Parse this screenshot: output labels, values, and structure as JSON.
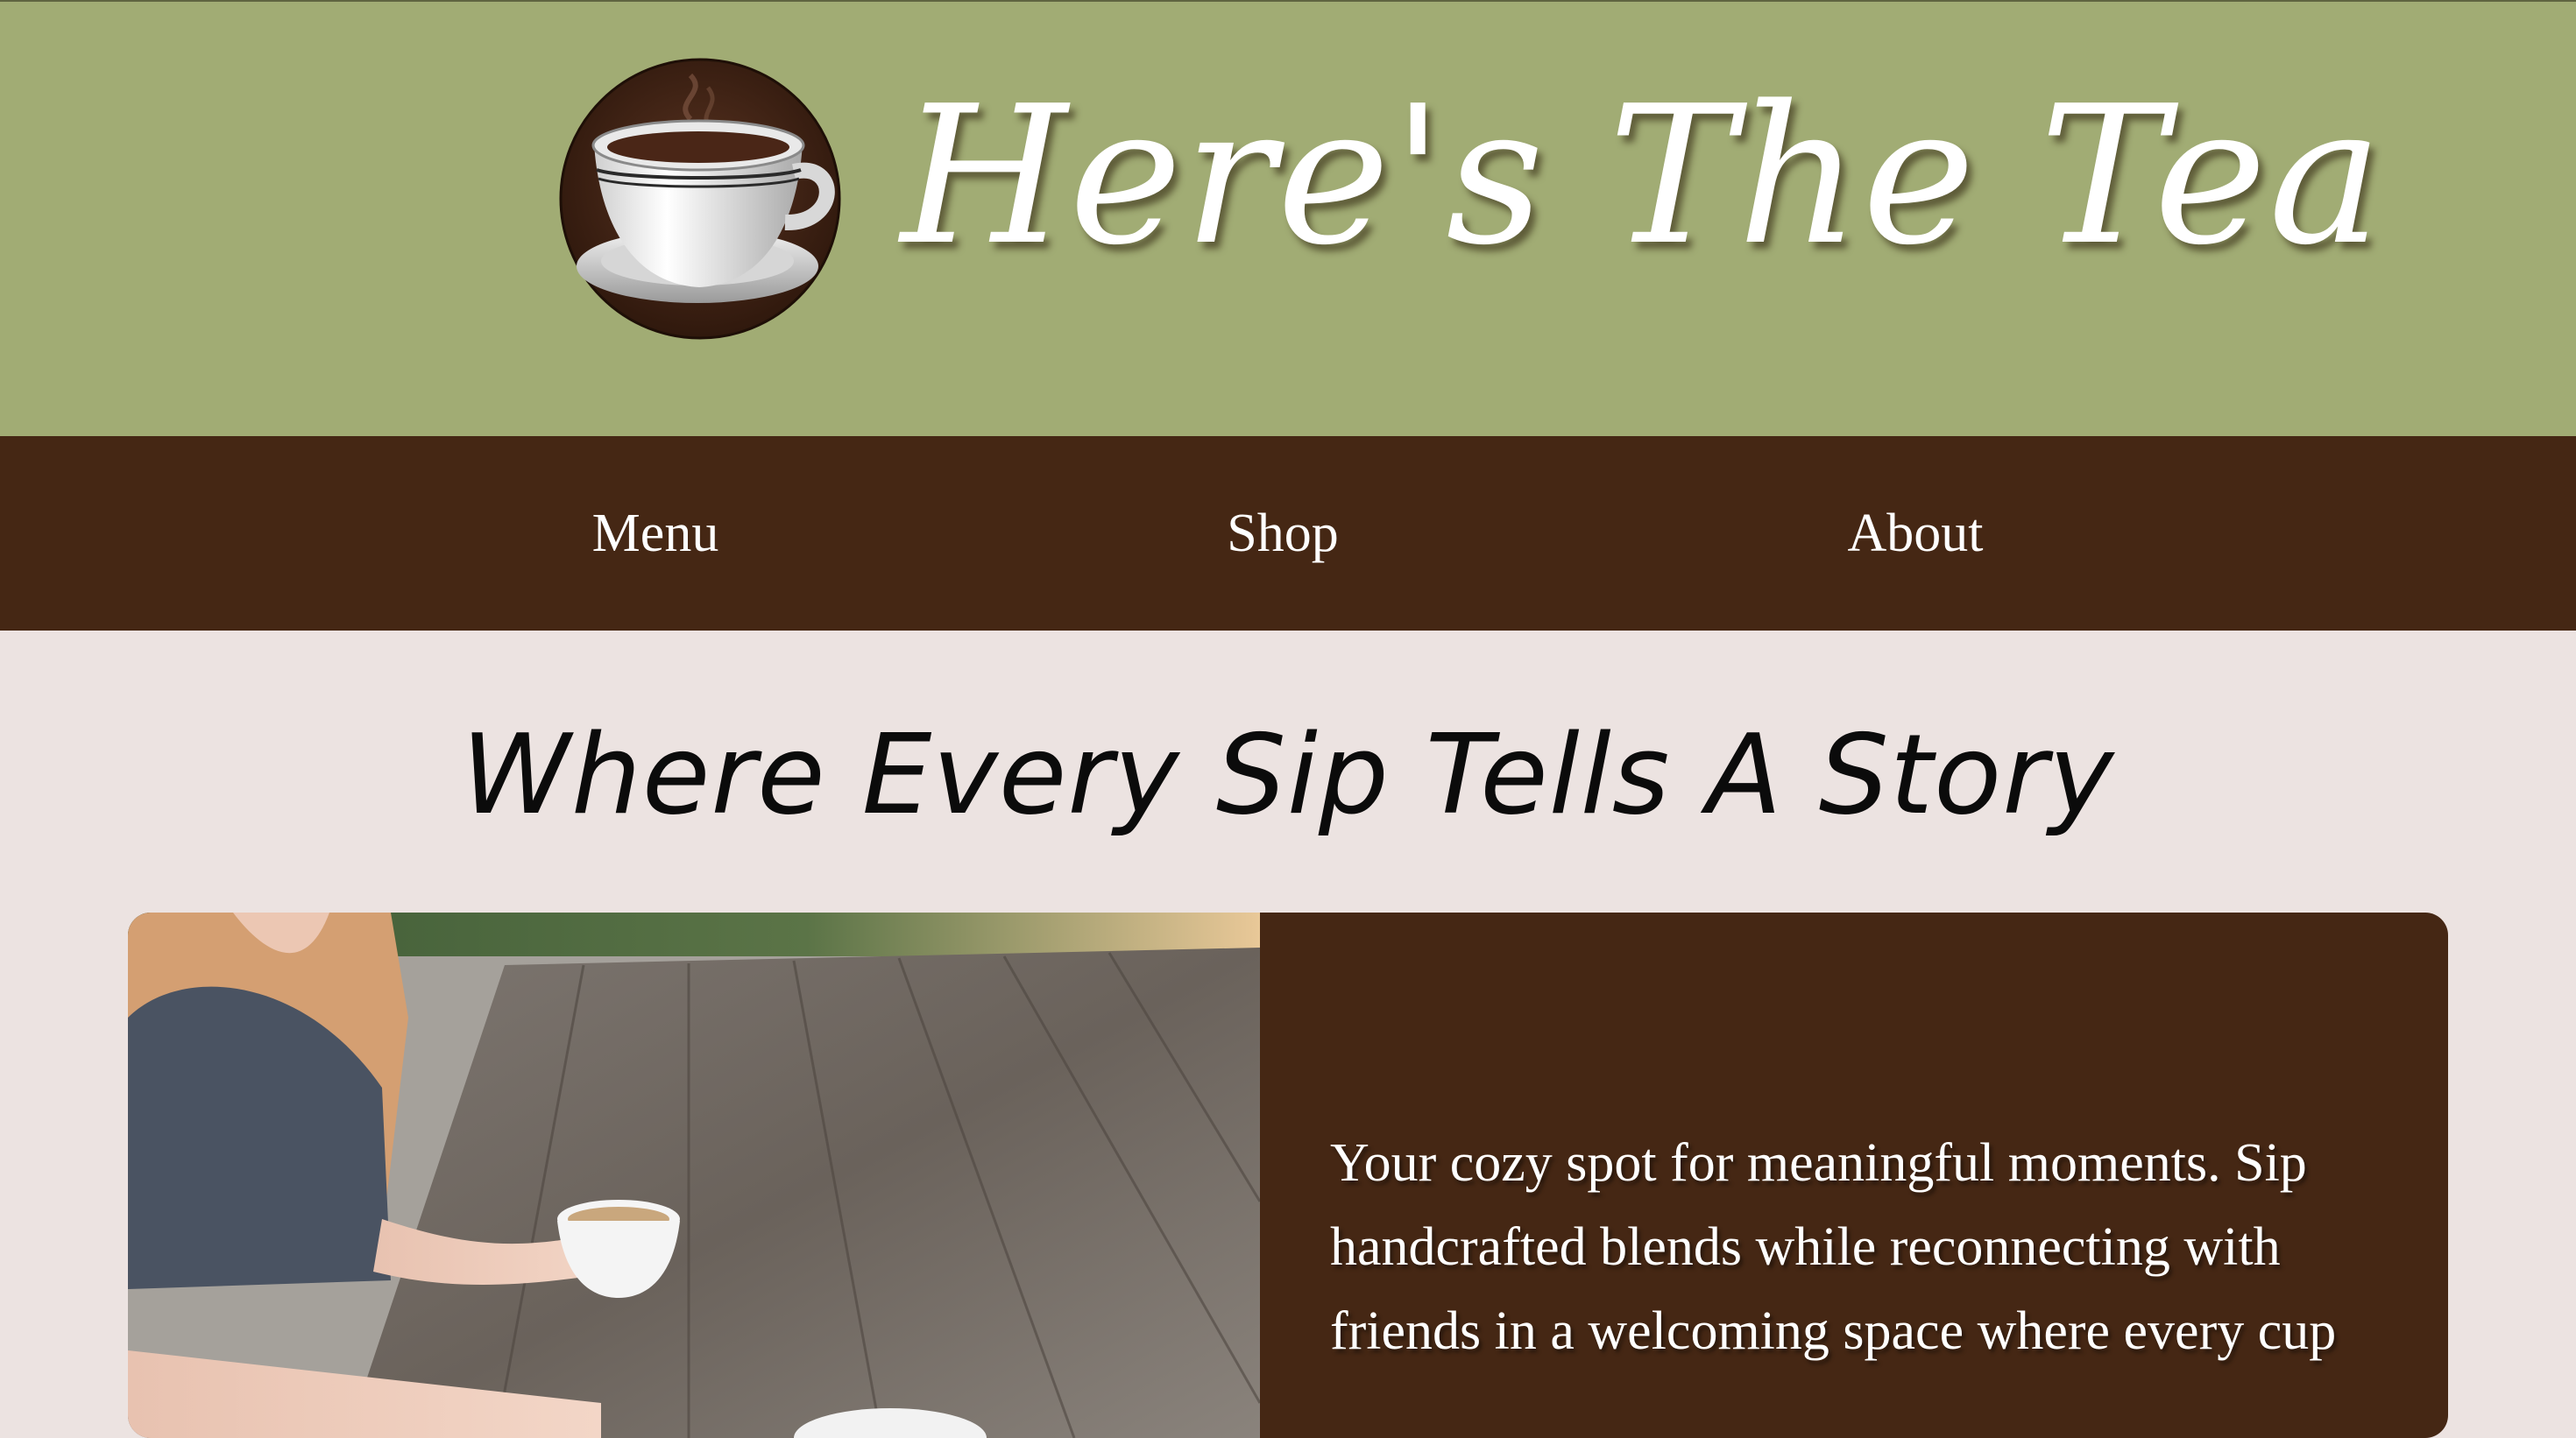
{
  "header": {
    "logo_icon": "tea-cup-icon",
    "title": "Here's The Tea"
  },
  "nav": {
    "items": [
      {
        "label": "Menu"
      },
      {
        "label": "Shop"
      },
      {
        "label": "About"
      }
    ]
  },
  "hero": {
    "heading": "Where Every Sip Tells A Story"
  },
  "feature": {
    "photo": "people-with-coffee-cups-at-wooden-table",
    "text": "Your cozy spot for meaningful moments. Sip handcrafted blends while reconnecting with friends in a welcoming space where every cup"
  },
  "colors": {
    "header_bg": "#a1ac74",
    "nav_bg": "#452714",
    "page_bg": "#ece3e1",
    "card_bg": "#452714"
  }
}
